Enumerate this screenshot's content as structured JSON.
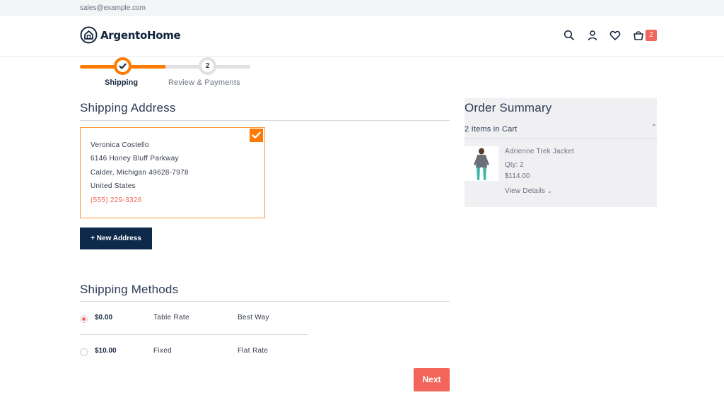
{
  "topbar": {
    "email": "sales@example.com"
  },
  "header": {
    "logo_text": "ArgentoHome",
    "icons": [
      "search-icon",
      "user-icon",
      "heart-icon",
      "cart-icon"
    ],
    "cart_count": "2"
  },
  "progress": {
    "steps": [
      {
        "label": "Shipping",
        "state": "complete"
      },
      {
        "number": "2",
        "label": "Review & Payments",
        "state": "pending"
      }
    ]
  },
  "shipping_address": {
    "title": "Shipping Address",
    "address": {
      "name": "Veronica Costello",
      "street": "6146 Honey Bluff Parkway",
      "city_line": "Calder, Michigan 49628-7978",
      "country": "United States",
      "phone": "(555) 229-3326",
      "selected": true
    },
    "new_address_label": "+ New Address"
  },
  "shipping_methods": {
    "title": "Shipping Methods",
    "methods": [
      {
        "price": "$0.00",
        "method": "Table Rate",
        "carrier": "Best Way",
        "selected": true
      },
      {
        "price": "$10.00",
        "method": "Fixed",
        "carrier": "Flat Rate",
        "selected": false
      }
    ]
  },
  "next_label": "Next",
  "order_summary": {
    "title": "Order Summary",
    "items_count": "2 Items in Cart",
    "item": {
      "name": "Adrienne Trek Jacket",
      "qty": "Qty: 2",
      "price": "$114.00",
      "view_details": "View Details"
    }
  },
  "colors": {
    "accent_orange": "#ff7a00",
    "coral": "#f2655a",
    "navy": "#0e2a4a"
  }
}
